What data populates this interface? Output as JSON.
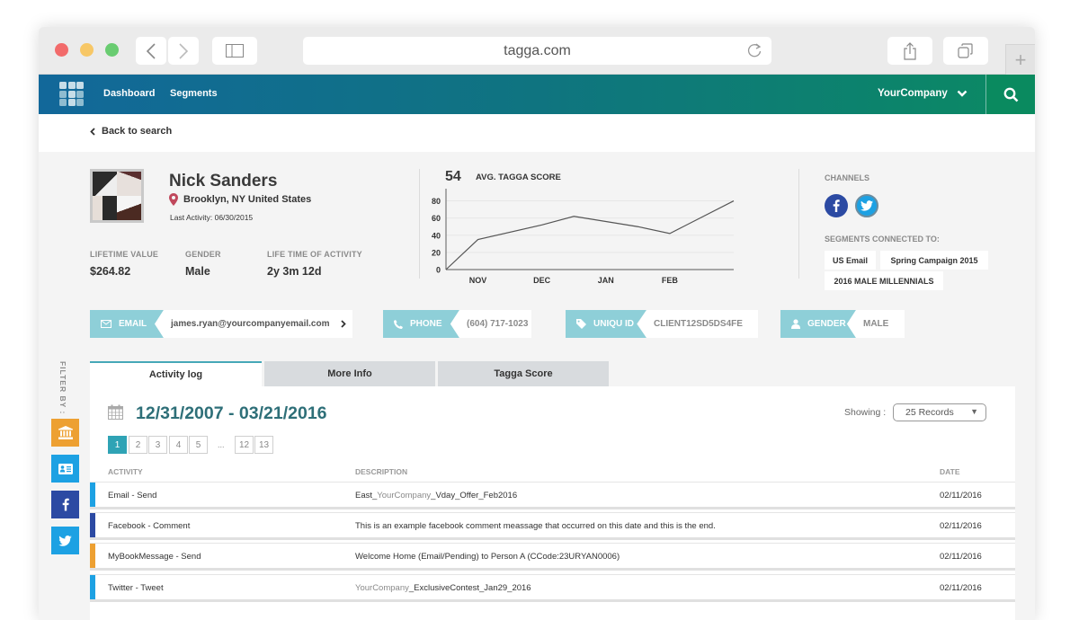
{
  "browser": {
    "url": "tagga.com",
    "traffic_lights": {
      "close": "#f26b6b",
      "minimize": "#f7c766",
      "maximize": "#69cc71"
    }
  },
  "nav": {
    "links": [
      "Dashboard",
      "Segments"
    ],
    "company": "YourCompany"
  },
  "back_label": "Back to search",
  "profile": {
    "name": "Nick Sanders",
    "location": "Brooklyn, NY United States",
    "last_activity": "Last Activity: 06/30/2015",
    "stats": [
      {
        "label": "LIFETIME VALUE",
        "value": "$264.82"
      },
      {
        "label": "GENDER",
        "value": "Male"
      },
      {
        "label": "LIFE TIME OF ACTIVITY",
        "value": "2y 3m 12d"
      }
    ]
  },
  "score": {
    "value": "54",
    "label": "AVG. TAGGA SCORE"
  },
  "chart_data": {
    "type": "line",
    "title": "AVG. TAGGA SCORE",
    "x_ticks": [
      "NOV",
      "DEC",
      "JAN",
      "FEB"
    ],
    "y_ticks": [
      0,
      20,
      40,
      60,
      80
    ],
    "ylim": [
      0,
      90
    ],
    "grid": true,
    "points": [
      {
        "x": 0,
        "y": 0
      },
      {
        "x": 0.5,
        "y": 35
      },
      {
        "x": 1.5,
        "y": 52
      },
      {
        "x": 2.0,
        "y": 62
      },
      {
        "x": 3.0,
        "y": 50
      },
      {
        "x": 3.5,
        "y": 42
      },
      {
        "x": 4.5,
        "y": 80
      }
    ],
    "xlabel": "",
    "ylabel": ""
  },
  "channels": {
    "label": "CHANNELS",
    "items": [
      {
        "name": "facebook",
        "glyph": "f",
        "color": "#2c4aa3"
      },
      {
        "name": "twitter",
        "glyph": "t",
        "color": "#1da1e3"
      }
    ]
  },
  "segments": {
    "label": "SEGMENTS CONNECTED TO:",
    "tags": [
      "US Email",
      "Spring Campaign 2015",
      "2016 MALE MILLENNIALS"
    ]
  },
  "fields": [
    {
      "label": "EMAIL",
      "value": "james.ryan@yourcompanyemail.com"
    },
    {
      "label": "PHONE",
      "value": "(604) 717-1023"
    },
    {
      "label": "UNIQU ID",
      "value": "CLIENT12SD5DS4FE"
    },
    {
      "label": "GENDER",
      "value": "MALE"
    }
  ],
  "filter": {
    "label": "FILTER BY :",
    "buttons": [
      {
        "name": "institution",
        "color": "#eda032"
      },
      {
        "name": "contact-card",
        "color": "#1da1e3"
      },
      {
        "name": "facebook",
        "color": "#2c4aa3"
      },
      {
        "name": "twitter",
        "color": "#1da1e3"
      }
    ]
  },
  "tabs": [
    "Activity log",
    "More Info",
    "Tagga Score"
  ],
  "activity": {
    "date_range": "12/31/2007 - 03/21/2016",
    "pages": [
      "1",
      "2",
      "3",
      "4",
      "5",
      "12",
      "13"
    ],
    "ellipsis": "...",
    "current_page": "1",
    "showing_label": "Showing :",
    "records": "25 Records",
    "columns": [
      "ACTIVITY",
      "DESCRIPTION",
      "DATE"
    ],
    "rows": [
      {
        "activity": "Email - Send",
        "desc_pre": "East_",
        "desc_muted": "YourCompany",
        "desc_post": "_Vday_Offer_Feb2016",
        "date": "02/11/2016",
        "color": "#1da1e3"
      },
      {
        "activity": "Facebook - Comment",
        "desc_pre": "This is an example facebook comment meassage that occurred on this date and this is the end.",
        "desc_muted": "",
        "desc_post": "",
        "date": "02/11/2016",
        "color": "#2c4aa3"
      },
      {
        "activity": "MyBookMessage - Send",
        "desc_pre": "Welcome Home (Email/Pending) to Person A (CCode:23URYAN0006)",
        "desc_muted": "",
        "desc_post": "",
        "date": "02/11/2016",
        "color": "#eda032"
      },
      {
        "activity": "Twitter - Tweet",
        "desc_pre": "",
        "desc_muted": "YourCompany",
        "desc_post": "_ExclusiveContest_Jan29_2016",
        "date": "02/11/2016",
        "color": "#1da1e3"
      }
    ]
  }
}
